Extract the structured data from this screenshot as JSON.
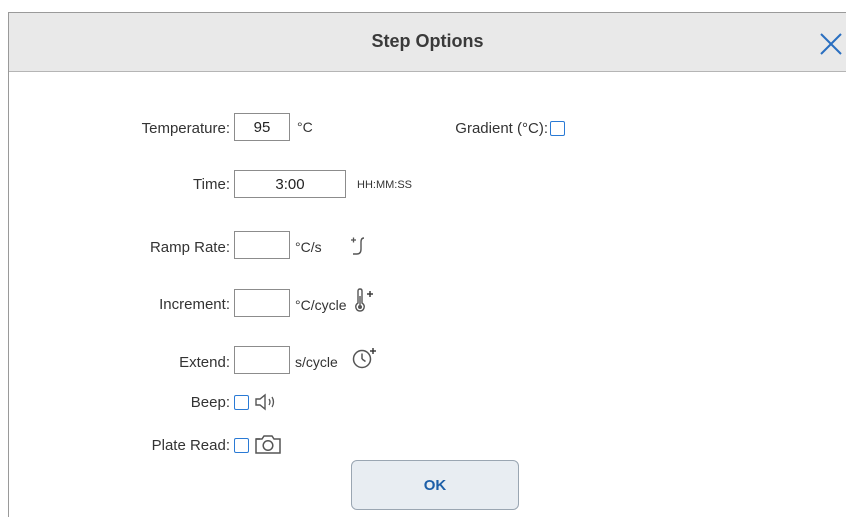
{
  "dialog": {
    "title": "Step Options"
  },
  "fields": {
    "temperature": {
      "label": "Temperature:",
      "value": "95",
      "unit": "°C"
    },
    "gradient": {
      "label": "Gradient (°C):",
      "checked": false
    },
    "time": {
      "label": "Time:",
      "value": "3:00",
      "unit": "HH:MM:SS"
    },
    "ramp_rate": {
      "label": "Ramp Rate:",
      "value": "",
      "unit": "°C/s"
    },
    "increment": {
      "label": "Increment:",
      "value": "",
      "unit": "°C/cycle"
    },
    "extend": {
      "label": "Extend:",
      "value": "",
      "unit": "s/cycle"
    },
    "beep": {
      "label": "Beep:",
      "checked": false
    },
    "plate_read": {
      "label": "Plate Read:",
      "checked": false
    }
  },
  "buttons": {
    "ok_label": "OK"
  },
  "colors": {
    "accent": "#2a7ad5",
    "title_bar": "#e9e9e9",
    "ok_text": "#1d5fa8"
  },
  "icons": [
    "close-icon",
    "ramp-rate-icon",
    "thermometer-plus-icon",
    "clock-plus-icon",
    "speaker-icon",
    "camera-icon"
  ]
}
